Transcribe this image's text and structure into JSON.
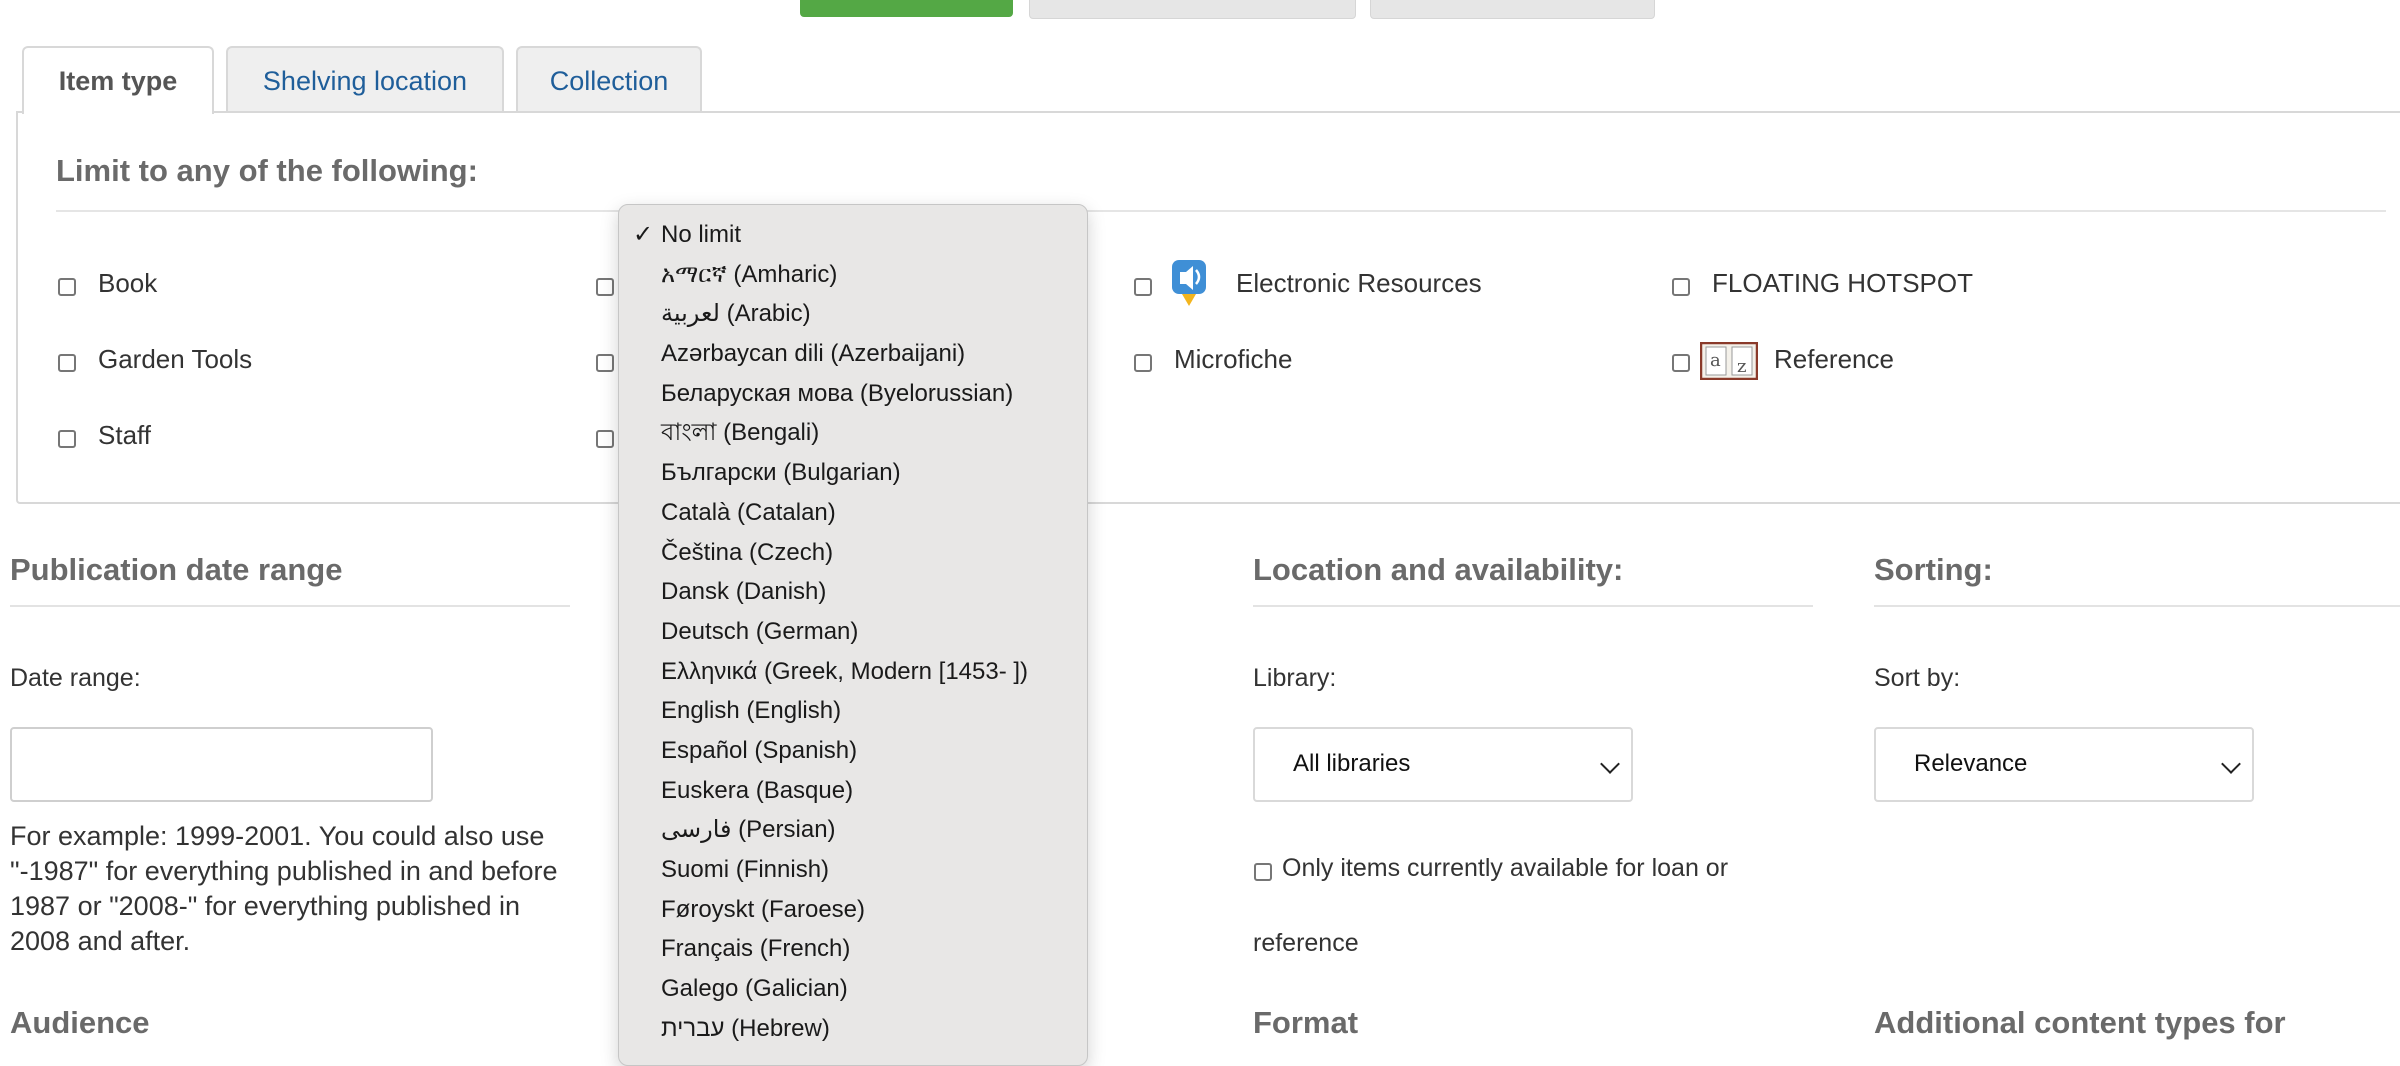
{
  "tabs": [
    {
      "label": "Item type",
      "active": true
    },
    {
      "label": "Shelving location",
      "active": false
    },
    {
      "label": "Collection",
      "active": false
    }
  ],
  "item_types": {
    "legend": "Limit to any of the following:",
    "items": [
      {
        "label": "Book"
      },
      {
        "label": "Electronic Resources",
        "icon": "speaker-download-icon"
      },
      {
        "label": "FLOATING HOTSPOT"
      },
      {
        "label": "Garden Tools"
      },
      {
        "label": "Microfiche"
      },
      {
        "label": "Reference",
        "icon": "az-icon"
      },
      {
        "label": "Staff"
      }
    ]
  },
  "language_dropdown": {
    "selected": "No limit",
    "options": [
      "No limit",
      "አማርኛ (Amharic)",
      "لعربية (Arabic)",
      "Azərbaycan dili (Azerbaijani)",
      "Беларуская мова (Byelorussian)",
      "বাংলা (Bengali)",
      "Български (Bulgarian)",
      "Català (Catalan)",
      "Čeština (Czech)",
      "Dansk (Danish)",
      "Deutsch (German)",
      "Ελληνικά (Greek, Modern [1453- ])",
      "English (English)",
      "Español (Spanish)",
      "Euskera (Basque)",
      "فارسی (Persian)",
      "Suomi (Finnish)",
      "Føroyskt (Faroese)",
      "Français (French)",
      "Galego (Galician)",
      "עברית (Hebrew)"
    ]
  },
  "publication": {
    "heading": "Publication date range",
    "label": "Date range:",
    "value": "",
    "help": "For example: 1999-2001. You could also use \"-1987\" for everything published in and before 1987 or \"2008-\" for everything published in 2008 and after."
  },
  "location": {
    "heading": "Location and availability:",
    "label": "Library:",
    "selected": "All libraries",
    "available_label": "Only items currently available for loan or",
    "available_label_2": "reference"
  },
  "sorting": {
    "heading": "Sorting:",
    "label": "Sort by:",
    "selected": "Relevance"
  },
  "bottom_headings": {
    "audience": "Audience",
    "format": "Format",
    "additional": "Additional content types for"
  },
  "colors": {
    "primary_button": "#54a845",
    "link": "#1f5e9a"
  }
}
